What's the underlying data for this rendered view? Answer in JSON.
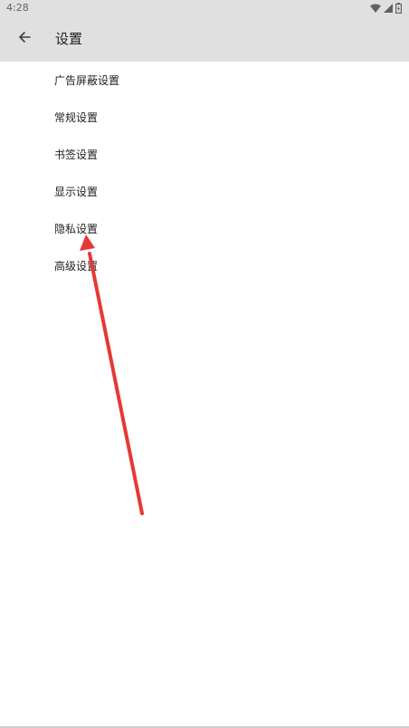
{
  "status_bar": {
    "time": "4:28",
    "icons": [
      "wifi-icon",
      "signal-icon",
      "battery-icon"
    ]
  },
  "app_bar": {
    "title": "设置",
    "back_icon": "arrow-left-icon"
  },
  "settings": {
    "items": [
      {
        "label": "广告屏蔽设置"
      },
      {
        "label": "常规设置"
      },
      {
        "label": "书签设置"
      },
      {
        "label": "显示设置"
      },
      {
        "label": "隐私设置"
      },
      {
        "label": "高级设置"
      }
    ]
  },
  "annotation": {
    "arrow_color": "#e53935",
    "points_to": "隐私设置"
  },
  "colors": {
    "app_bar_bg": "#e0e0e0",
    "background": "#ffffff",
    "text": "#202124"
  }
}
